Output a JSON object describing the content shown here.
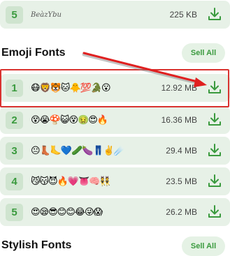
{
  "top_font": {
    "number": "5",
    "preview": "BeàzYbu",
    "size": "225 KB"
  },
  "emoji_section": {
    "title": "Emoji Fonts",
    "sell_all": "Sell All",
    "items": [
      {
        "number": "1",
        "preview": "😷🦁🐯🐱🐥💯🐊😮",
        "size": "12.92 MB"
      },
      {
        "number": "2",
        "preview": "😵😭🍄😺😵🤢😍🔥",
        "size": "16.36 MB"
      },
      {
        "number": "3",
        "preview": "😐👢🦶💙🥒🍆👖✌️☄️",
        "size": "29.4 MB"
      },
      {
        "number": "4",
        "preview": "😼😽😈🔥💗👅🧠👯",
        "size": "23.5 MB"
      },
      {
        "number": "5",
        "preview": "😍😪😎😊😊😂😜😱",
        "size": "26.2 MB"
      }
    ]
  },
  "stylish_section": {
    "title": "Stylish Fonts",
    "sell_all": "Sell All"
  },
  "colors": {
    "accent": "#3a9a3e",
    "card": "#e7f1e7",
    "highlight": "#d9322f"
  },
  "icons": {
    "download": "download-icon"
  }
}
